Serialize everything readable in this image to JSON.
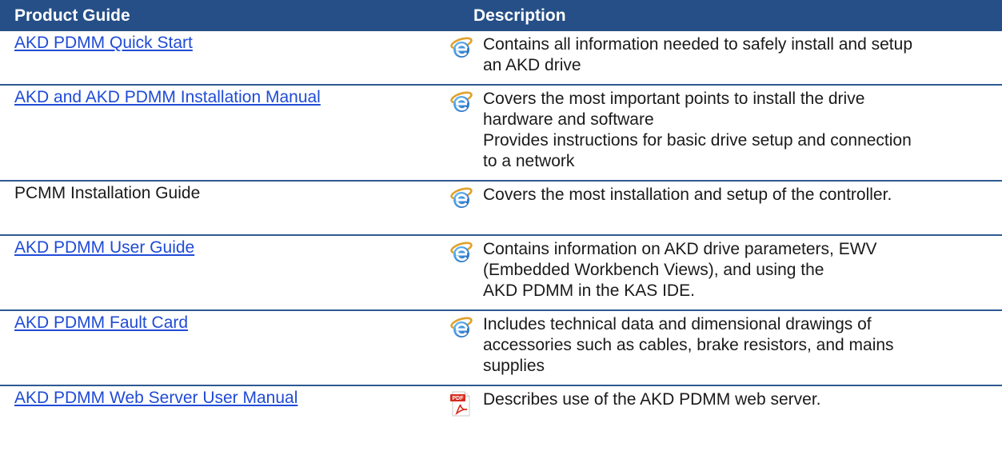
{
  "table": {
    "header": {
      "product_guide": "Product Guide",
      "description": "Description"
    },
    "rows": [
      {
        "guide": "AKD PDMM Quick Start",
        "is_link": true,
        "icon": "internet-explorer-icon",
        "description": [
          "Contains all information needed to safely install and setup",
          "an AKD drive"
        ]
      },
      {
        "guide": "AKD and AKD PDMM Installation Manual",
        "is_link": true,
        "icon": "internet-explorer-icon",
        "description": [
          "Covers the most important points to install the drive",
          "hardware and software",
          "Provides instructions for basic drive setup and connection",
          "to a network"
        ]
      },
      {
        "guide": "PCMM Installation Guide",
        "is_link": false,
        "icon": "internet-explorer-icon",
        "description": [
          "Covers the most installation and setup of the controller."
        ]
      },
      {
        "guide": "AKD PDMM User Guide",
        "is_link": true,
        "icon": "internet-explorer-icon",
        "description": [
          "Contains information on AKD drive parameters, EWV",
          "(Embedded Workbench Views), and using the",
          "AKD PDMM in the KAS IDE."
        ]
      },
      {
        "guide": "AKD PDMM Fault Card",
        "is_link": true,
        "icon": "internet-explorer-icon",
        "description": [
          "Includes technical data and dimensional drawings of",
          "accessories such as cables, brake resistors, and mains",
          "supplies"
        ]
      },
      {
        "guide": "AKD PDMM Web Server User Manual",
        "is_link": true,
        "icon": "pdf-icon",
        "description": [
          "Describes use of the AKD PDMM web server."
        ]
      }
    ]
  },
  "colors": {
    "header_bg": "#264f87",
    "header_text": "#ffffff",
    "link": "#1f4bd6",
    "row_divider": "#2e5991"
  },
  "pdf_icon_label": "PDF"
}
